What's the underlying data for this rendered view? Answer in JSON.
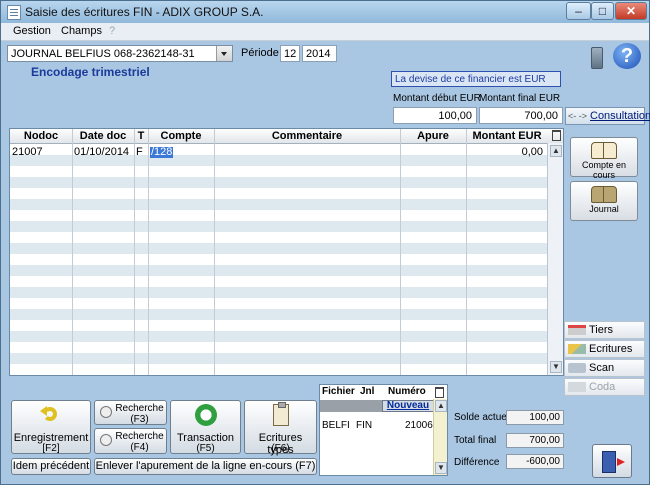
{
  "window": {
    "title": "Saisie des écritures FIN   -   ADIX GROUP S.A.",
    "controls": {
      "minimize": "–",
      "maximize": "□",
      "close": "✕"
    }
  },
  "menu": {
    "items": [
      {
        "label": "Gestion"
      },
      {
        "label": "Champs"
      },
      {
        "label": "?"
      }
    ]
  },
  "header": {
    "journal": "JOURNAL BELFIUS 068-2362148-31",
    "periode_label": "Période",
    "periode_month": "12",
    "periode_year": "2014",
    "subtitle": "Encodage trimestriel",
    "devise_notice": "La devise de ce financier est EUR",
    "montant_debut_label": "Montant début EUR",
    "montant_final_label": "Montant final EUR",
    "montant_debut": "100,00",
    "montant_final": "700,00",
    "consultations_label": "Consultations",
    "consultations_arrows": "<- ->"
  },
  "grid": {
    "columns": [
      "Nodoc",
      "Date doc",
      "T",
      "Compte",
      "Commentaire",
      "Apure",
      "Montant EUR"
    ],
    "rows": [
      {
        "nodoc": "21007",
        "date": "01/10/2014",
        "t": "F",
        "compte": "/128",
        "commentaire": "",
        "apure": "",
        "montant": "0,00"
      }
    ]
  },
  "sidebar": {
    "compte_en_cours": "Compte en cours",
    "journal": "Journal",
    "items": [
      {
        "label": "Tiers"
      },
      {
        "label": "Ecritures"
      },
      {
        "label": "Scan"
      },
      {
        "label": "Coda"
      }
    ]
  },
  "buttons": {
    "enregistrement": "Enregistrement",
    "enregistrement_key": "[F2]",
    "recherche_f3": "Recherche",
    "recherche_f3_key": "(F3)",
    "recherche_f4": "Recherche",
    "recherche_f4_key": "(F4)",
    "transaction": "Transaction",
    "transaction_key": "(F5)",
    "ecritures_types": "Ecritures types",
    "ecritures_types_key": "(F6)",
    "idem_precedent": "Idem précédent",
    "enlever_apurement": "Enlever l'apurement de la ligne en-cours (F7)"
  },
  "mini_table": {
    "columns": [
      "Fichier",
      "Jnl",
      "Numéro"
    ],
    "nouveau_label": "Nouveau",
    "rows": [
      {
        "fichier": "BELFI",
        "jnl": "FIN",
        "numero": "21006"
      }
    ]
  },
  "totals": {
    "solde_actuel_label": "Solde actuel",
    "solde_actuel": "100,00",
    "total_final_label": "Total final",
    "total_final": "700,00",
    "difference_label": "Différence",
    "difference": "-600,00"
  }
}
